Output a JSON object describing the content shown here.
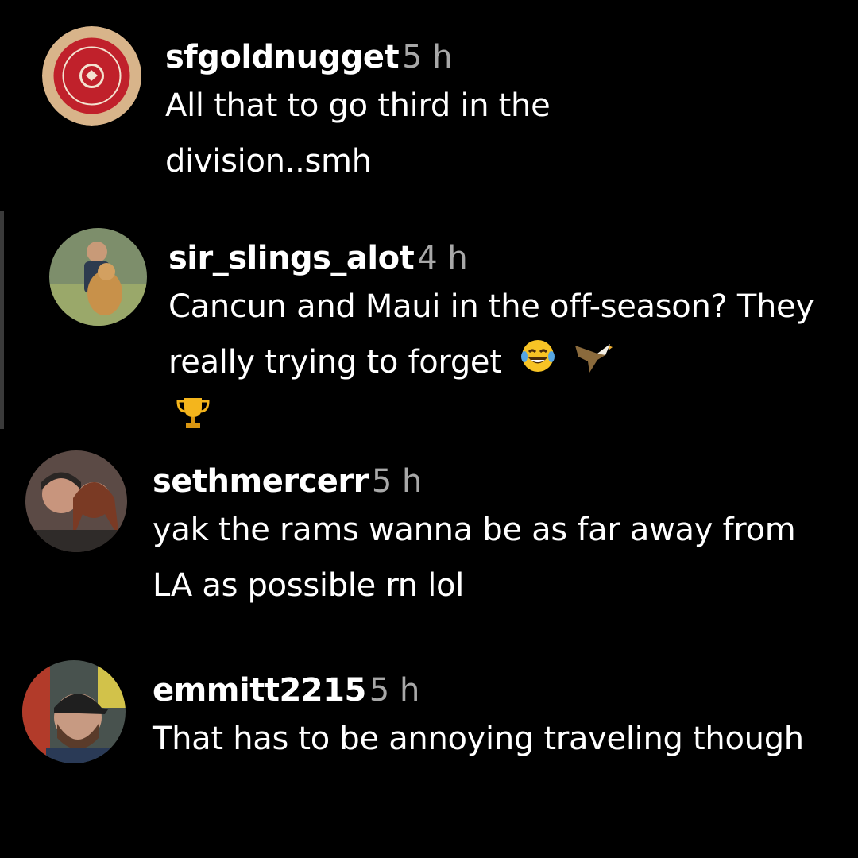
{
  "comments": [
    {
      "username": "sfgoldnugget",
      "time": "5 h",
      "text": "All that to go third in the division..smh",
      "avatar": "badge-logo-avatar"
    },
    {
      "username": "sir_slings_alot",
      "time": "4 h",
      "text": "Cancun and Maui in the off-season? They really trying to forget",
      "emojis": [
        "laughing-tears-icon",
        "eagle-icon",
        "trophy-icon"
      ],
      "avatar": "person-with-dog-avatar"
    },
    {
      "username": "sethmercerr",
      "time": "5 h",
      "text": "yak the rams wanna be as far away from LA as possible rn lol",
      "avatar": "couple-photo-avatar"
    },
    {
      "username": "emmitt2215",
      "time": "5 h",
      "text": "That has to be annoying traveling though",
      "avatar": "man-in-cap-avatar"
    }
  ],
  "colors": {
    "background": "#000000",
    "username": "#ffffff",
    "timestamp": "#a8a8a8",
    "thread_line": "#3a3a3a"
  }
}
